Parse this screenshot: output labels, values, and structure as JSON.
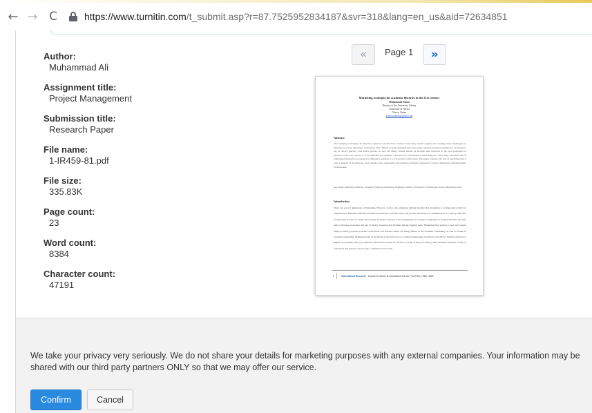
{
  "browser": {
    "back_icon": "←",
    "forward_icon": "→",
    "reload_icon": "C",
    "url_host": "https://www.turnitin.com",
    "url_path": "/t_submit.asp?r=87.7525952834187&svr=318&lang=en_us&aid=72634851"
  },
  "meta": {
    "items": [
      {
        "label": "Author:",
        "value": "Muhammad Ali"
      },
      {
        "label": "Assignment title:",
        "value": "Project Management"
      },
      {
        "label": "Submission title:",
        "value": "Research Paper"
      },
      {
        "label": "File name:",
        "value": "1-IR459-81.pdf"
      },
      {
        "label": "File size:",
        "value": "335.83K"
      },
      {
        "label": "Page count:",
        "value": "23"
      },
      {
        "label": "Word count:",
        "value": "8384"
      },
      {
        "label": "Character count:",
        "value": "47191"
      }
    ]
  },
  "pager": {
    "prev_icon": "«",
    "page_label": "Page 1",
    "next_icon": "»"
  },
  "preview": {
    "title": "Marketing strategies for academic libraries in the 21st century",
    "author": "Muhammad Aslam",
    "affiliation1": "Director of the University Library",
    "affiliation2": "University of Nizwa",
    "affiliation3": "Nizwa, Oman",
    "email": "aslam.muslim@gmail.com",
    "abstract_heading": "Abstract",
    "abstract_text": "The emerging technology in libraries, explosion of electronic resources and many search engines are creating many challenges for libraries as well as librarians. A relevancy of the library is being questioned by users while commercial search engines are increasing to use by library patrons. This article focuses on how the library should market its facilities and resources to the new generation of libraries in the 21st century. It is as important for academic libraries how to formulate a marketing plan while many librarians do not understand themselves as marketers although marketing is a crucial role of librarians. This paper explores the role of marketing that is with a support of the libraries, and includes some suggestions of marketing strategies proposed to current librarians and information professionals.",
    "keywords": "Keywords: Academic Libraries, Strategic Planning, Marketing Strategies, Library Promotion, Promotional Events, Marketing Tools",
    "intro_heading": "Introduction",
    "intro_text": "There are several definitions of marketing. However, Kotler and Armstrong (2014) describe that marketing is an important activity to organizations. Marketers identify unsatisfied demand for customer needs and provide information to administrators to come up with new products and services to satisfy those needs. In terms of library, active marketing is an essential component to promote libraries that may help to increase awareness and use of library resources and facilities among targeted users. Marketing may present a clear and concise image as library patrons in terms of resources and services which are being offered in the academic community as well as visible to continued expanding. Marketing team of the library is the best way to coordinate marketing activities for the library. Whether physical or digital, an academic library's collection and services would be relevant to usage if they are used by their intended audience. Usage of collections and services are not only a reflection of how well",
    "footer_num": "1",
    "footer_journal": "International Research:",
    "footer_rest": "Journal of Library & Information Science | Vol.8 No.1 Mar., 2018"
  },
  "privacy": {
    "text": "We take your privacy very seriously. We do not share your details for marketing purposes with any external companies. Your information may be shared with our third party partners ONLY so that we may offer our service.",
    "confirm_label": "Confirm",
    "cancel_label": "Cancel"
  }
}
